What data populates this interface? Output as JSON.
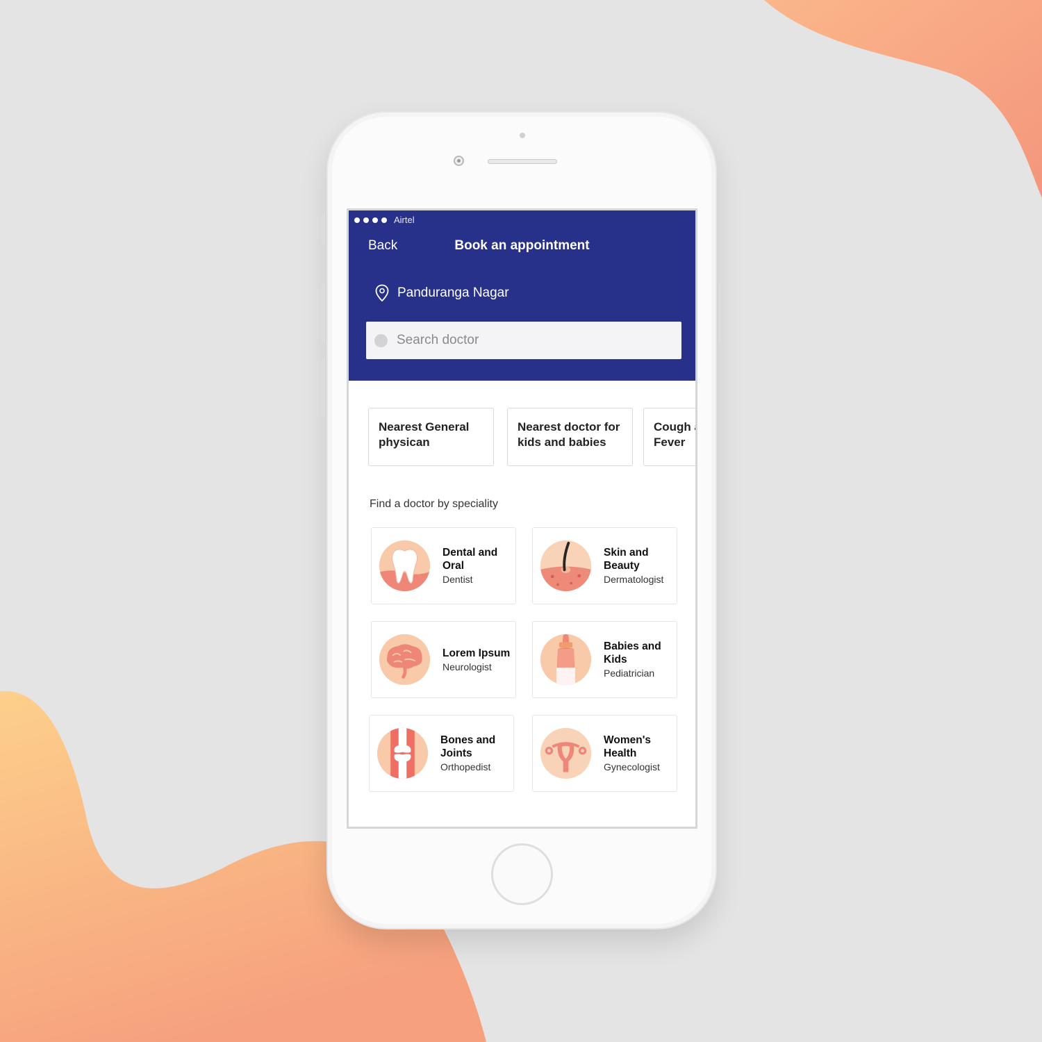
{
  "status_bar": {
    "carrier": "Airtel"
  },
  "nav": {
    "back_label": "Back",
    "title": "Book an appointment"
  },
  "location": {
    "icon": "location-pin-icon",
    "name": "Panduranga Nagar"
  },
  "search": {
    "placeholder": "Search doctor"
  },
  "quick_chips": [
    {
      "label_line1": "Nearest General",
      "label_line2": "physican"
    },
    {
      "label_line1": "Nearest doctor for",
      "label_line2": "kids and babies"
    },
    {
      "label_line1": "Cough and",
      "label_line2": "Fever"
    }
  ],
  "specialities": {
    "heading": "Find a doctor by speciality",
    "items": [
      {
        "title_line1": "Dental and",
        "title_line2": "Oral",
        "subtitle": "Dentist",
        "icon": "tooth-icon"
      },
      {
        "title_line1": "Skin and",
        "title_line2": "Beauty",
        "subtitle": "Dermatologist",
        "icon": "skin-hair-icon"
      },
      {
        "title_line1": "Lorem Ipsum",
        "title_line2": "",
        "subtitle": "Neurologist",
        "icon": "brain-icon"
      },
      {
        "title_line1": "Babies and",
        "title_line2": "Kids",
        "subtitle": "Pediatrician",
        "icon": "baby-bottle-icon"
      },
      {
        "title_line1": "Bones and",
        "title_line2": "Joints",
        "subtitle": "Orthopedist",
        "icon": "bone-joint-icon"
      },
      {
        "title_line1": "Women's",
        "title_line2": "Health",
        "subtitle": "Gynecologist",
        "icon": "uterus-icon"
      }
    ]
  },
  "colors": {
    "header": "#27318a",
    "accent_orange": "#f39b78",
    "icon_peach": "#f7c9a8"
  }
}
